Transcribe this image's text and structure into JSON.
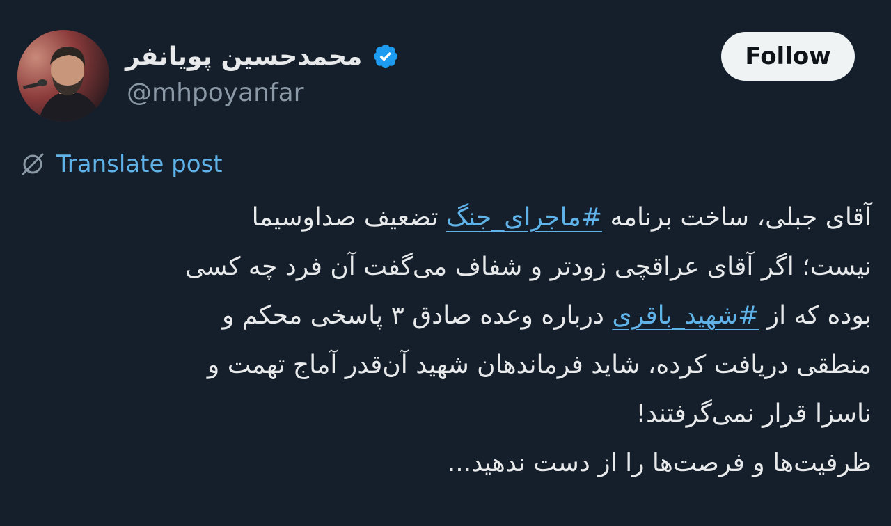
{
  "author": {
    "display_name": "محمدحسین پویانفر",
    "handle": "@mhpoyanfar",
    "verified": true,
    "verified_color": "#1d9bf0"
  },
  "follow_button": {
    "label": "Follow"
  },
  "translate": {
    "label": "Translate post",
    "icon": "translate-icon"
  },
  "tweet": {
    "lines": [
      {
        "before": "آقای جبلی، ساخت برنامه ",
        "hashtag": "#ماجرای_جنگ",
        "after": " تضعیف صداوسیما"
      },
      {
        "text": "نیست؛ اگر آقای عراقچی زودتر و شفاف می‌گفت آن فرد چه کسی"
      },
      {
        "before": "بوده که از ",
        "hashtag": "#شهید_باقری",
        "after": " درباره وعده صادق ۳ پاسخی محکم و"
      },
      {
        "text": "منطقی دریافت کرده، شاید فرماندهان شهید آن‌قدر آماج تهمت و"
      },
      {
        "text": "ناسزا قرار نمی‌گرفتند!"
      },
      {
        "text": "ظرفیت‌ها و فرصت‌ها را از دست ندهید..."
      }
    ]
  },
  "colors": {
    "background": "#151f2b",
    "text": "#e7e9ea",
    "secondary": "#8b98a5",
    "link": "#5fb3e8",
    "follow_bg": "#eff3f4"
  }
}
